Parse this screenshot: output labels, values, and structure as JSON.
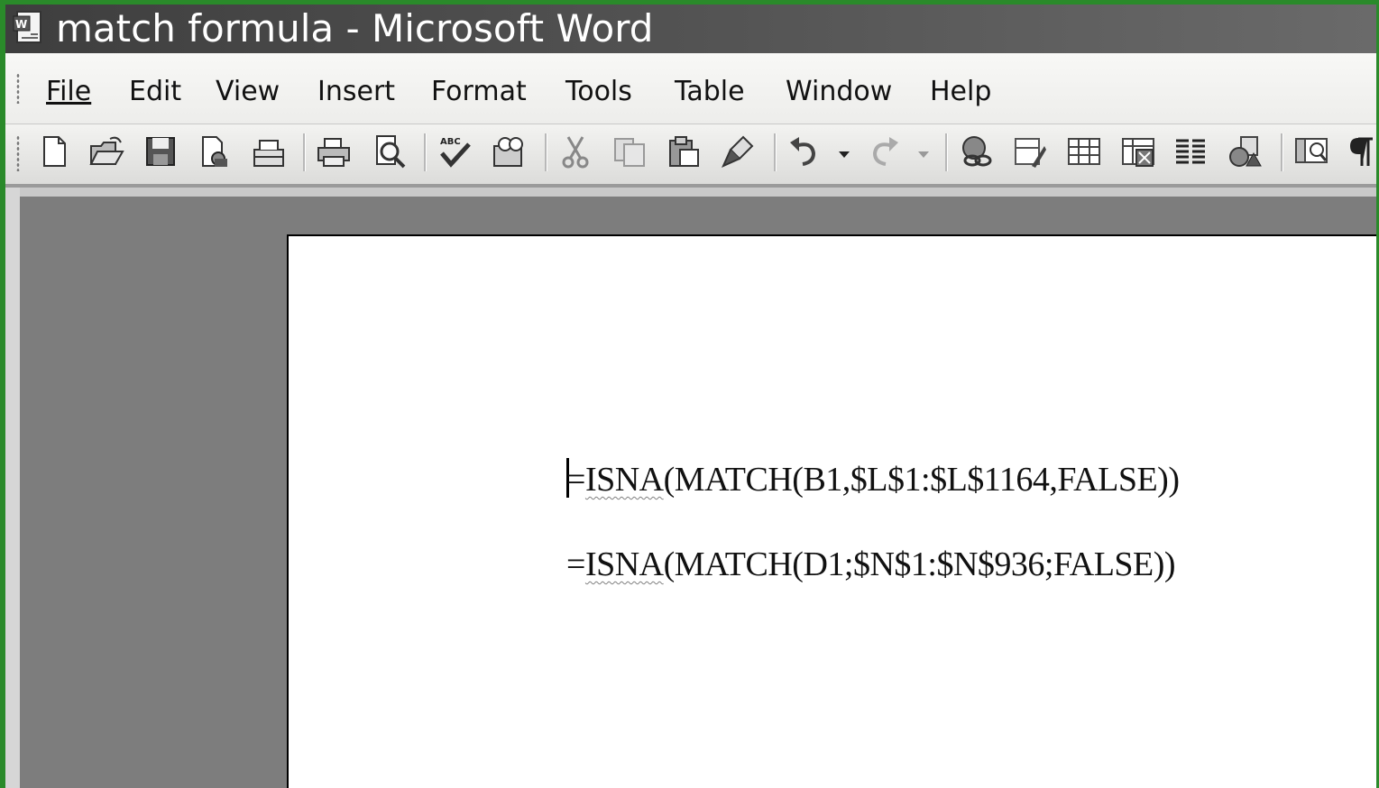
{
  "window": {
    "title": "match formula - Microsoft Word"
  },
  "menubar": {
    "items": [
      "File",
      "Edit",
      "View",
      "Insert",
      "Format",
      "Tools",
      "Table",
      "Window",
      "Help"
    ]
  },
  "toolbar": {
    "icons": [
      "new-document-icon",
      "open-icon",
      "save-icon",
      "permission-icon",
      "email-icon",
      "print-icon",
      "print-preview-icon",
      "spelling-icon",
      "research-icon",
      "cut-icon",
      "copy-icon",
      "paste-icon",
      "format-painter-icon",
      "undo-icon",
      "undo-dropdown-icon",
      "redo-icon",
      "redo-dropdown-icon",
      "hyperlink-icon",
      "tables-borders-icon",
      "insert-table-icon",
      "insert-excel-icon",
      "columns-icon",
      "drawing-icon",
      "document-map-icon",
      "show-formatting-icon"
    ]
  },
  "document": {
    "lines": [
      {
        "spell_flag": "ISNA",
        "rest": "(MATCH(B1,$L$1:$L$1164,FALSE))",
        "prefix": "="
      },
      {
        "spell_flag": "ISNA",
        "rest": "(MATCH(D1;$N$1:$N$936;FALSE))",
        "prefix": "="
      }
    ]
  },
  "colors": {
    "desktop_border": "#2a8a2a",
    "titlebar": "#4a4a4a",
    "workspace": "#7d7d7d",
    "page": "#ffffff"
  }
}
